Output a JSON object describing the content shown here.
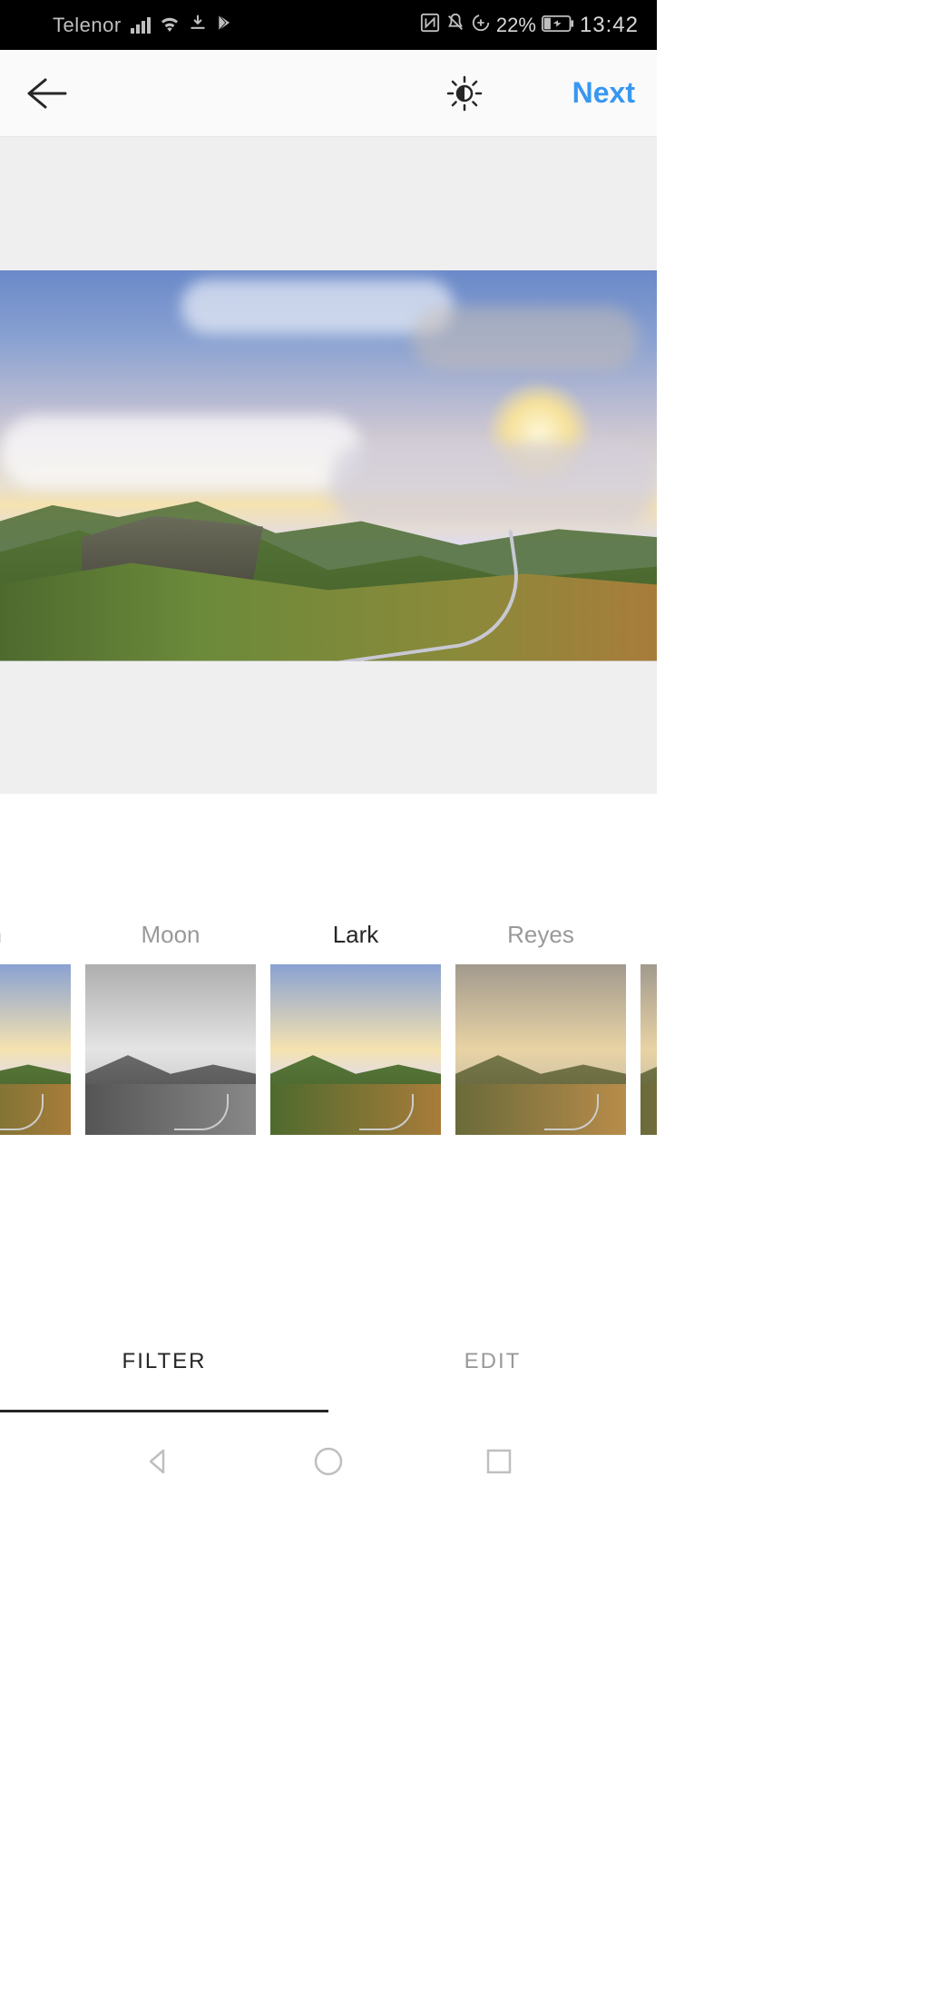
{
  "status": {
    "carrier": "Telenor",
    "battery_pct": "22%",
    "time": "13:42"
  },
  "header": {
    "next_label": "Next"
  },
  "filters": {
    "items": [
      {
        "label": "am"
      },
      {
        "label": "Moon"
      },
      {
        "label": "Lark"
      },
      {
        "label": "Reyes"
      },
      {
        "label": ""
      }
    ],
    "selected_index": 2
  },
  "tabs": {
    "filter_label": "FILTER",
    "edit_label": "EDIT",
    "active": "filter"
  }
}
